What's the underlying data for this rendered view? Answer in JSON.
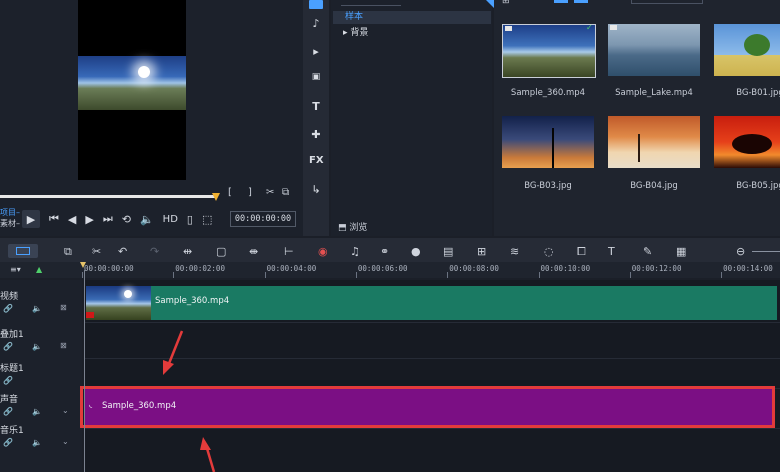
{
  "preview": {
    "timecode": "00:00:00:00",
    "hd_label": "HD",
    "side_labels": [
      "项目–",
      "素材–"
    ],
    "bracket_in": "[",
    "bracket_out": "]"
  },
  "library": {
    "tree": {
      "sample": "样本",
      "background": "背景"
    },
    "browse_label": "浏览",
    "media": [
      {
        "label": "Sample_360.mp4",
        "thumb": "panorama",
        "checked": true
      },
      {
        "label": "Sample_Lake.mp4",
        "thumb": "lake"
      },
      {
        "label": "BG-B01.jpg",
        "thumb": "tree-green"
      },
      {
        "label": "BG-B03.jpg",
        "thumb": "tree-dusk"
      },
      {
        "label": "BG-B04.jpg",
        "thumb": "desert"
      },
      {
        "label": "BG-B05.jpg",
        "thumb": "tree-red"
      }
    ]
  },
  "timeline": {
    "ruler": [
      "00:00:00:00",
      "00:00:02:00",
      "00:00:04:00",
      "00:00:06:00",
      "00:00:08:00",
      "00:00:10:00",
      "00:00:12:00",
      "00:00:14:00"
    ],
    "tracks": [
      {
        "name": "视频"
      },
      {
        "name": "叠加1"
      },
      {
        "name": "标题1"
      },
      {
        "name": "声音"
      },
      {
        "name": "音乐1"
      }
    ],
    "video_clip_label": "Sample_360.mp4",
    "audio_clip_label": "Sample_360.mp4"
  },
  "colors": {
    "video_clip": "#1a7a63",
    "audio_clip": "#7b0f84",
    "highlight": "#e33b3b",
    "accent": "#4aa0ff"
  }
}
